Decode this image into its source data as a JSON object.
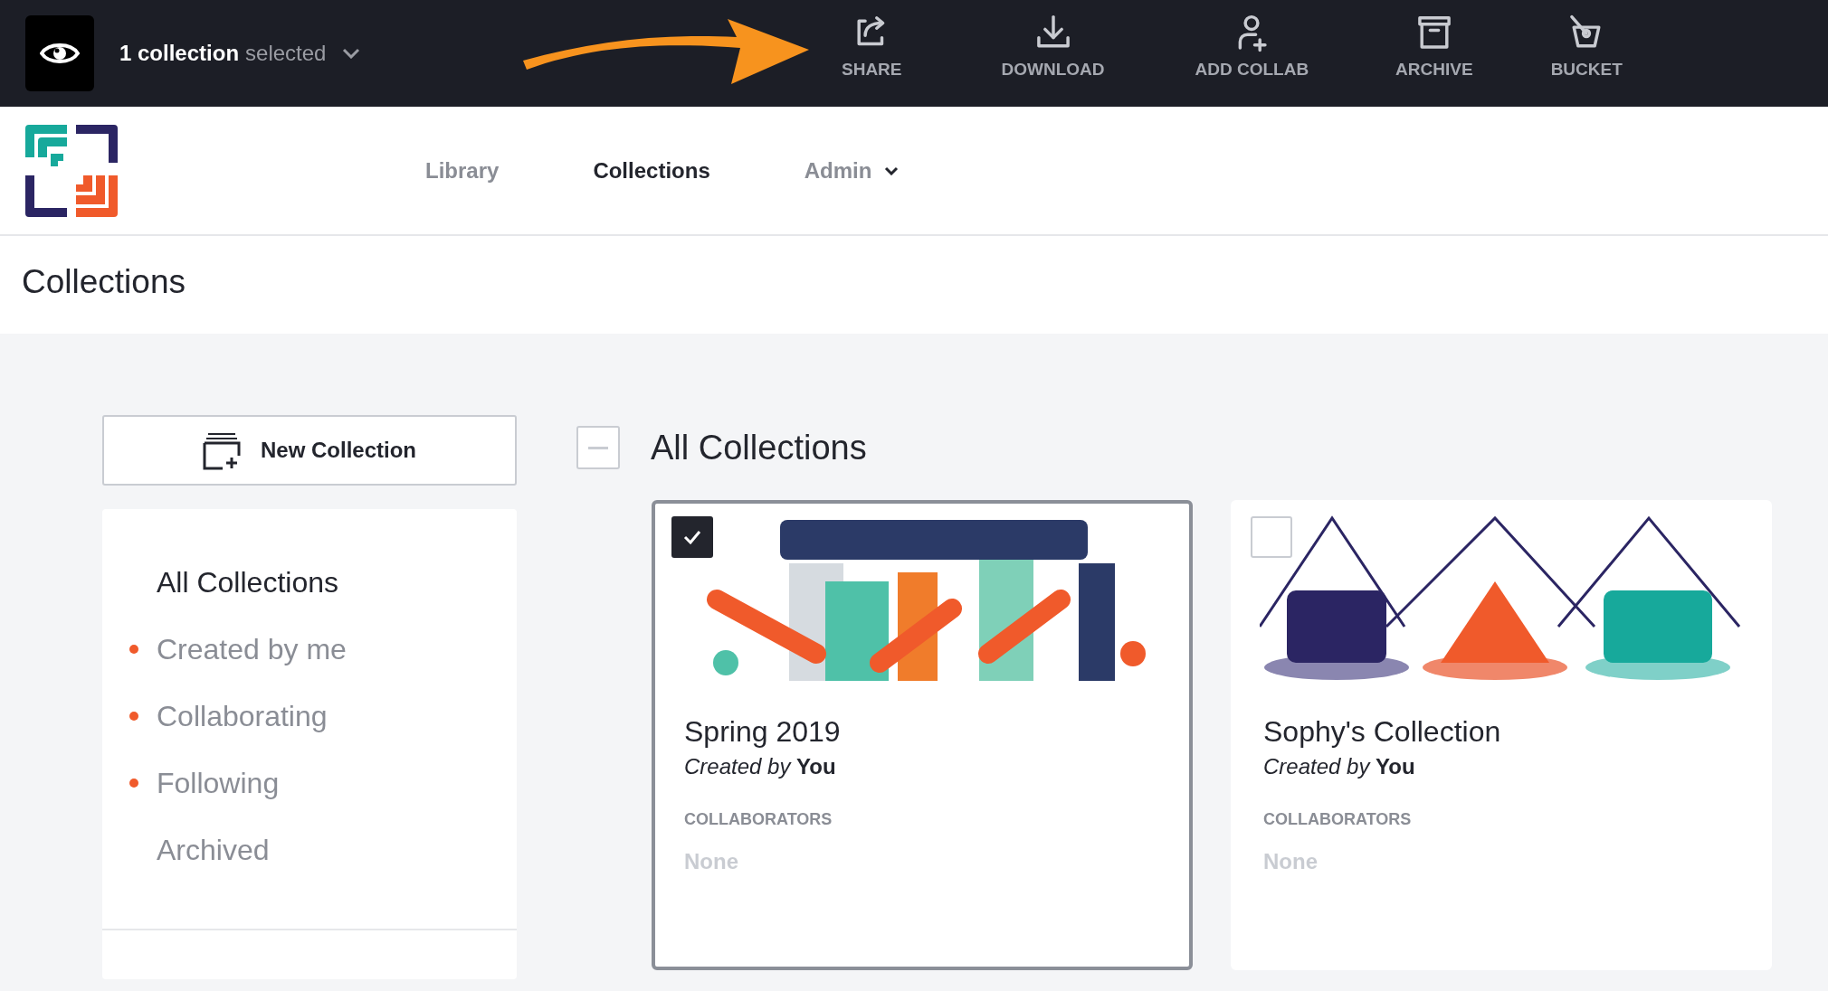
{
  "selection_bar": {
    "count": "1 collection",
    "suffix": "selected",
    "actions": [
      {
        "kind": "share",
        "label": "SHARE"
      },
      {
        "kind": "download",
        "label": "DOWNLOAD"
      },
      {
        "kind": "add-collab",
        "label": "ADD COLLAB"
      },
      {
        "kind": "archive",
        "label": "ARCHIVE"
      },
      {
        "kind": "bucket",
        "label": "BUCKET"
      }
    ]
  },
  "nav": [
    {
      "label": "Library",
      "selected": false,
      "dropdown": false
    },
    {
      "label": "Collections",
      "selected": true,
      "dropdown": false
    },
    {
      "label": "Admin",
      "selected": false,
      "dropdown": true
    }
  ],
  "page_title": "Collections",
  "new_collection_button": "New Collection",
  "sidebar": [
    {
      "label": "All Collections",
      "selected": true,
      "bullet": false
    },
    {
      "label": "Created by me",
      "selected": false,
      "bullet": true
    },
    {
      "label": "Collaborating",
      "selected": false,
      "bullet": true
    },
    {
      "label": "Following",
      "selected": false,
      "bullet": true
    },
    {
      "label": "Archived",
      "selected": false,
      "bullet": false
    }
  ],
  "list_header": {
    "title": "All Collections",
    "partial_selection": true
  },
  "collections": [
    {
      "title": "Spring 2019",
      "created_by_prefix": "Created by",
      "creator": "You",
      "collaborators_label": "COLLABORATORS",
      "collaborators": "None",
      "selected": true
    },
    {
      "title": "Sophy's Collection",
      "created_by_prefix": "Created by",
      "creator": "You",
      "collaborators_label": "COLLABORATORS",
      "collaborators": "None",
      "selected": false
    }
  ]
}
